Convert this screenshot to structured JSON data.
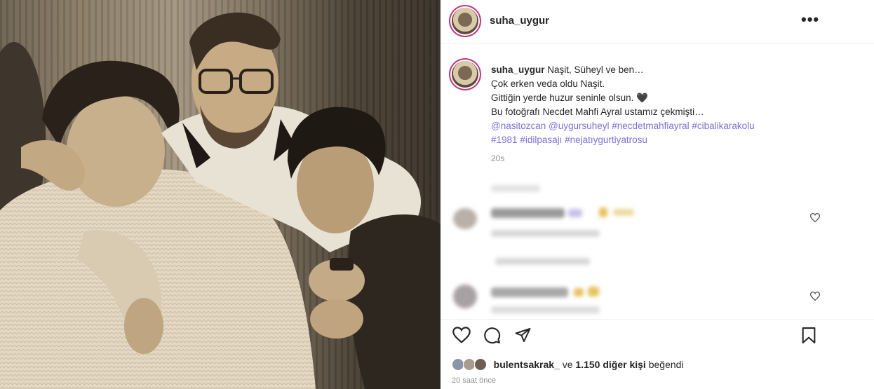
{
  "post": {
    "username": "suha_uygur",
    "more_label": "•••"
  },
  "caption": {
    "username": "suha_uygur",
    "lines": [
      "Naşit, Süheyl ve ben…",
      "Çok erken veda oldu Naşit.",
      "Gittiğin yerde huzur seninle olsun.",
      "Bu fotoğrafı Necdet Mahfi Ayral ustamız çekmişti…"
    ],
    "heart_emoji": "🖤",
    "tags_line1": [
      "@nasitozcan",
      "@uygursuheyl",
      "#necdetmahfiayral",
      "#cibalikarakolu"
    ],
    "tags_line2": [
      "#1981",
      "#idilpasajı",
      "#nejatıygurtiyatrosu"
    ],
    "time": "20s"
  },
  "likes": {
    "user": "bulentsakrak_",
    "connector": "ve",
    "count_text": "1.150 diğer kişi",
    "suffix": "beğendi"
  },
  "post_time": "20 saat önce",
  "colors": {
    "hashtag": "#7c70d8",
    "story_ring": "#c13584",
    "muted": "#8e8e8e"
  },
  "icons": [
    "more-icon",
    "heart-icon",
    "comment-icon",
    "share-icon",
    "bookmark-icon"
  ]
}
